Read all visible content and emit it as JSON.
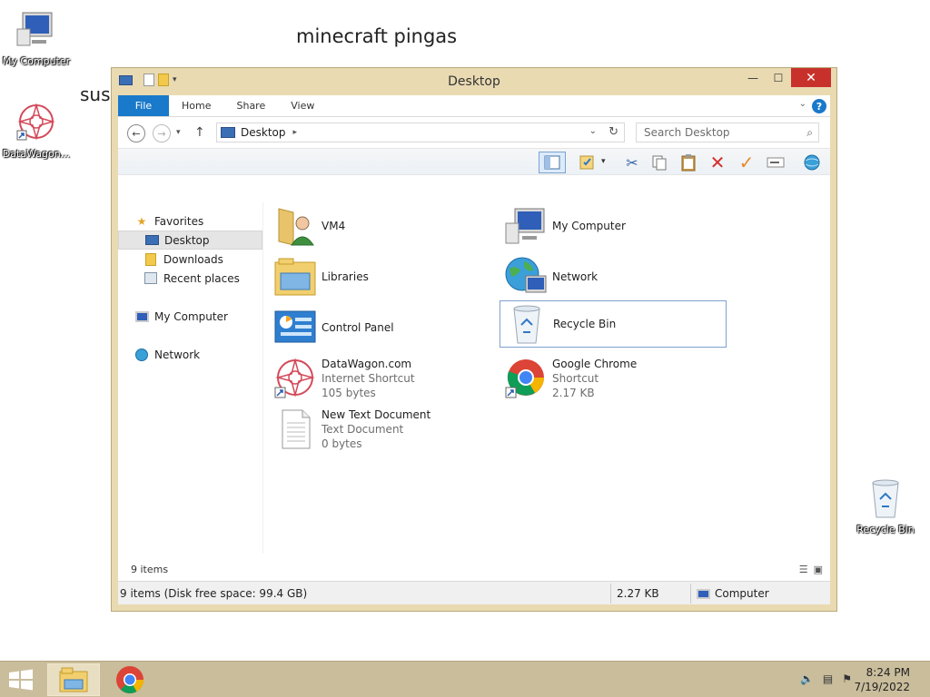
{
  "desktop": {
    "icons": [
      {
        "label": "My Computer"
      },
      {
        "label": "DataWagon..."
      },
      {
        "label": "Recycle Bin"
      }
    ],
    "texts": [
      "minecraft pingas",
      "sus"
    ]
  },
  "window": {
    "title": "Desktop",
    "ribbon_tabs": [
      "File",
      "Home",
      "Share",
      "View"
    ],
    "address": {
      "location": "Desktop"
    },
    "search": {
      "placeholder": "Search Desktop"
    },
    "nav": {
      "favorites": "Favorites",
      "desktop": "Desktop",
      "downloads": "Downloads",
      "recent": "Recent places",
      "my_computer": "My Computer",
      "network": "Network"
    },
    "items": [
      {
        "name": "VM4",
        "icon": "user-folder-icon"
      },
      {
        "name": "My Computer",
        "icon": "computer-icon"
      },
      {
        "name": "Libraries",
        "icon": "libraries-icon"
      },
      {
        "name": "Network",
        "icon": "network-globe-icon"
      },
      {
        "name": "Control Panel",
        "icon": "control-panel-icon"
      },
      {
        "name": "Recycle Bin",
        "icon": "recycle-bin-icon"
      },
      {
        "name": "DataWagon.com",
        "type": "Internet Shortcut",
        "size": "105 bytes",
        "icon": "datawagon-shortcut-icon"
      },
      {
        "name": "Google Chrome",
        "type": "Shortcut",
        "size": "2.17 KB",
        "icon": "chrome-shortcut-icon"
      },
      {
        "name": "New Text Document",
        "type": "Text Document",
        "size": "0 bytes",
        "icon": "text-document-icon"
      }
    ],
    "status": {
      "count": "9 items",
      "summary": "9 items (Disk free space: 99.4 GB)",
      "size": "2.27 KB",
      "location": "Computer"
    }
  },
  "taskbar": {
    "clock_time": "8:24 PM",
    "clock_date": "7/19/2022"
  },
  "colors": {
    "window_frame": "#e9dab2",
    "file_tab": "#1979ca",
    "close_button": "#c8312b",
    "taskbar": "#c9bd9c"
  }
}
